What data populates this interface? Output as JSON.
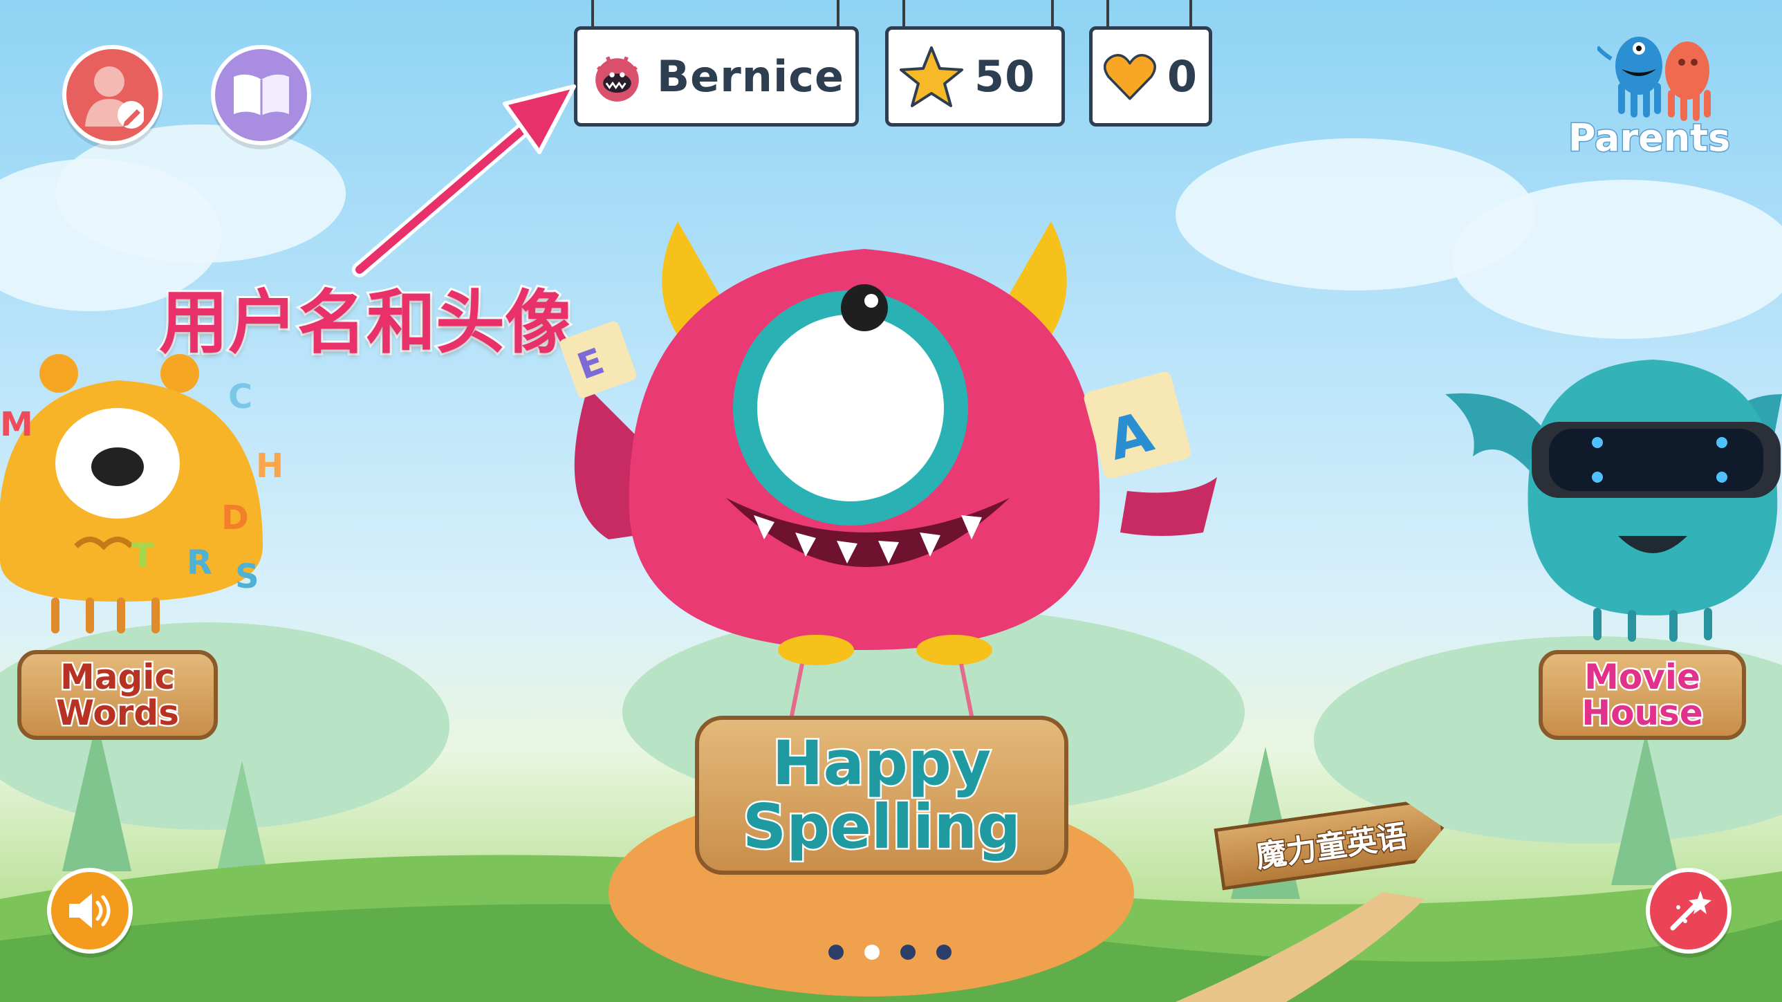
{
  "hud": {
    "username": "Bernice",
    "stars": "50",
    "hearts": "0"
  },
  "annotation": {
    "label": "用户名和头像"
  },
  "parents": {
    "label": "Parents"
  },
  "cards": {
    "left_line1": "Magic",
    "left_line2": "Words",
    "center_line1": "Happy",
    "center_line2": "Spelling",
    "right_line1": "Movie",
    "right_line2": "House"
  },
  "signpost": {
    "label": "魔力童英语"
  },
  "colors": {
    "accent_pink": "#e8316a",
    "hud_border": "#2c3e50",
    "teal_text": "#1f9aa0",
    "magenta_text": "#e2318a",
    "red_text": "#b83224"
  },
  "icons": {
    "profile": "user-edit-icon",
    "book": "book-icon",
    "star": "star-icon",
    "heart": "heart-icon",
    "sound": "speaker-icon",
    "magic": "magic-wand-icon"
  },
  "pager": {
    "count": 4,
    "active_index": 1
  }
}
